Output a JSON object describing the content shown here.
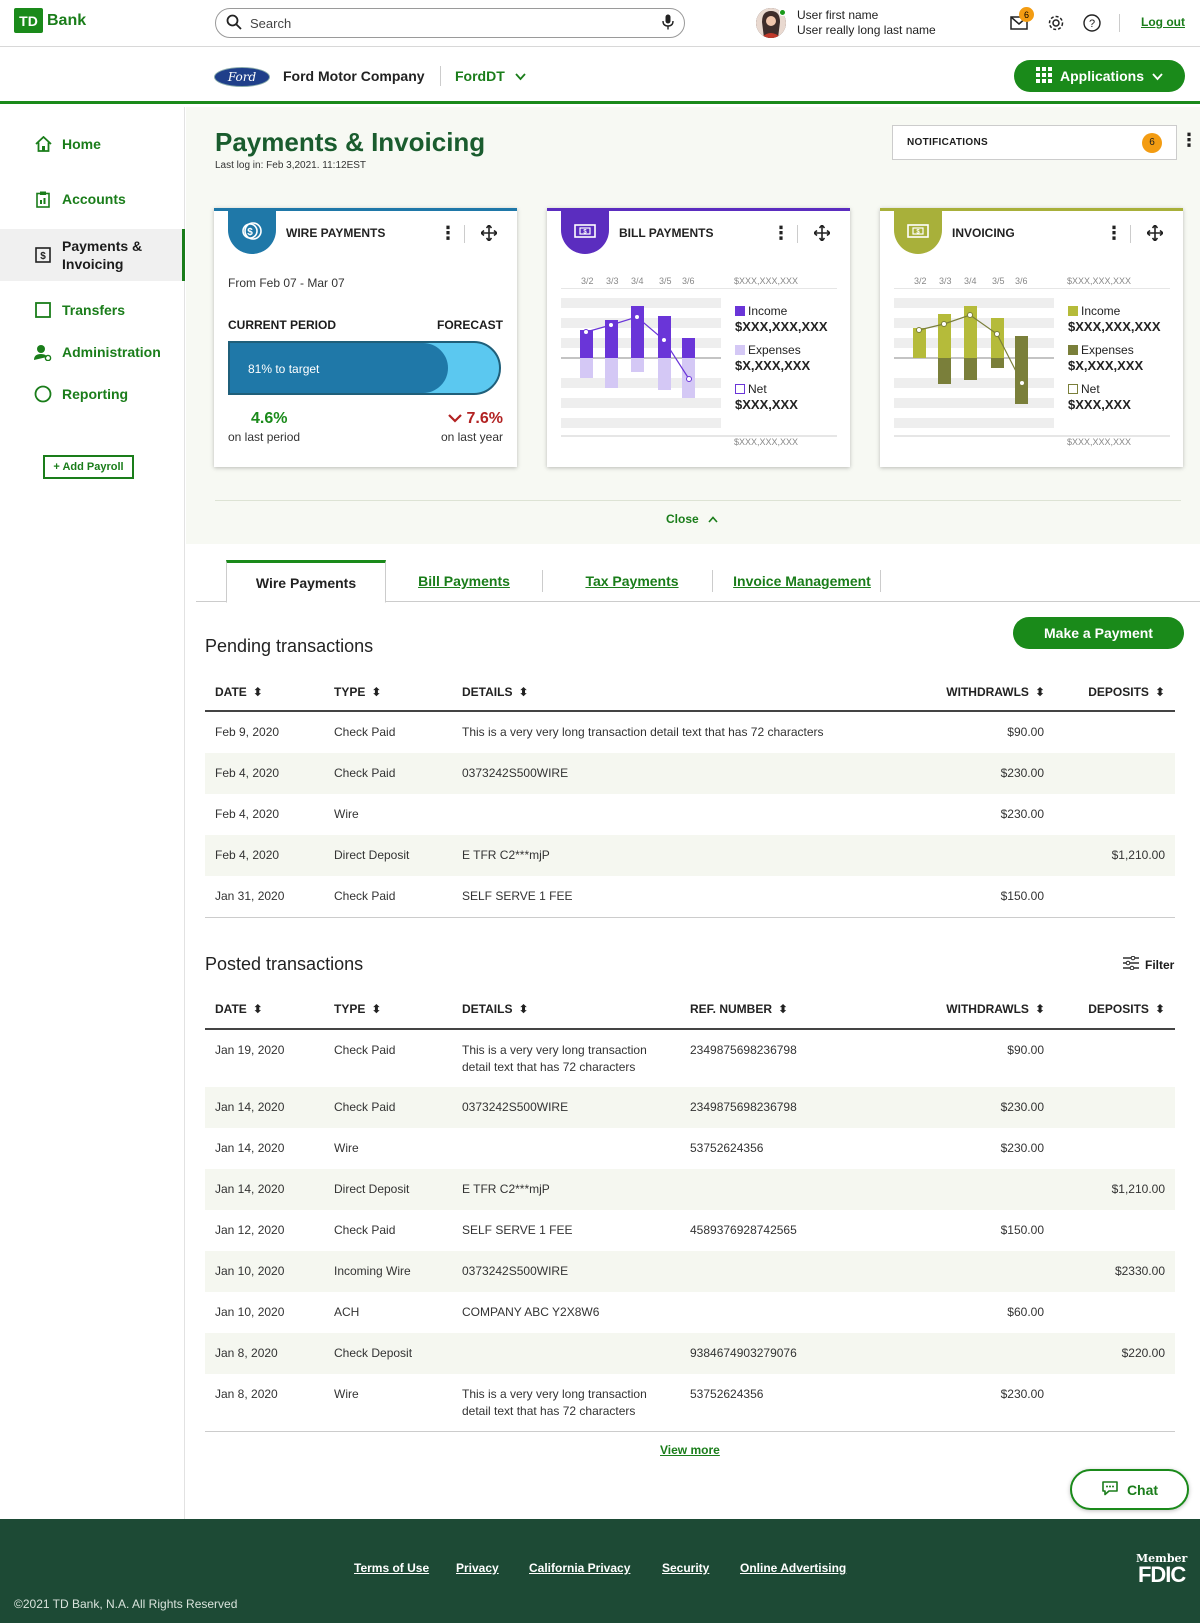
{
  "header": {
    "logo_box": "TD",
    "logo_text": "Bank",
    "search_placeholder": "Search",
    "user_first": "User first name",
    "user_last": "User really long last name",
    "mail_count": "6",
    "logout": "Log out"
  },
  "subbar": {
    "ford_logo": "Ford",
    "company": "Ford Motor Company",
    "account": "FordDT",
    "applications": "Applications"
  },
  "sidebar": {
    "items": [
      {
        "label": "Home"
      },
      {
        "label": "Accounts"
      },
      {
        "label": "Payments & Invoicing"
      },
      {
        "label": "Transfers"
      },
      {
        "label": "Administration"
      },
      {
        "label": "Reporting"
      }
    ],
    "add_payroll": "+ Add Payroll"
  },
  "dashboard": {
    "title": "Payments & Invoicing",
    "last_log": "Last log in: Feb 3,2021. 11:12EST",
    "notifications_label": "NOTIFICATIONS",
    "notifications_count": "6",
    "close": "Close",
    "colors": {
      "wire": "#1f78a8",
      "bill": "#5b2dbf",
      "invoice": "#a8b03a"
    },
    "wire": {
      "title": "WIRE PAYMENTS",
      "range": "From Feb 07 - Mar 07",
      "current_label": "CURRENT PERIOD",
      "forecast_label": "FORECAST",
      "progress_text": "81% to target",
      "progress_value": 0.81,
      "left_value": "4.6%",
      "left_caption": "on last period",
      "right_value": "7.6%",
      "right_caption": "on last year"
    },
    "bill": {
      "title": "BILL PAYMENTS",
      "dates": [
        "3/2",
        "3/3",
        "3/4",
        "3/5",
        "3/6"
      ],
      "top_label": "$XXX,XXX,XXX",
      "bottom_label": "$XXX,XXX,XXX",
      "income_label": "Income",
      "income_value": "$XXX,XXX,XXX",
      "expenses_label": "Expenses",
      "expenses_value": "$X,XXX,XXX",
      "net_label": "Net",
      "net_value": "$XXX,XXX"
    },
    "invoicing": {
      "title": "INVOICING",
      "dates": [
        "3/2",
        "3/3",
        "3/4",
        "3/5",
        "3/6"
      ],
      "top_label": "$XXX,XXX,XXX",
      "bottom_label": "$XXX,XXX,XXX",
      "income_label": "Income",
      "income_value": "$XXX,XXX,XXX",
      "expenses_label": "Expenses",
      "expenses_value": "$X,XXX,XXX",
      "net_label": "Net",
      "net_value": "$XXX,XXX"
    }
  },
  "tabs": [
    {
      "label": "Wire Payments"
    },
    {
      "label": "Bill Payments"
    },
    {
      "label": "Tax Payments"
    },
    {
      "label": "Invoice Management"
    }
  ],
  "pending": {
    "title": "Pending transactions",
    "make_payment": "Make a Payment",
    "headers": [
      "DATE",
      "TYPE",
      "DETAILS",
      "WITHDRAWLS",
      "DEPOSITS"
    ],
    "rows": [
      {
        "date": "Feb 9, 2020",
        "type": "Check Paid",
        "details": "This is a very very long transaction detail text that has 72 characters",
        "withdrawls": "$90.00",
        "deposits": ""
      },
      {
        "date": "Feb 4, 2020",
        "type": "Check Paid",
        "details": "0373242S500WIRE",
        "withdrawls": "$230.00",
        "deposits": ""
      },
      {
        "date": "Feb 4, 2020",
        "type": "Wire",
        "details": "",
        "withdrawls": "$230.00",
        "deposits": ""
      },
      {
        "date": "Feb 4, 2020",
        "type": "Direct Deposit",
        "details": "E TFR C2***mjP",
        "withdrawls": "",
        "deposits": "$1,210.00"
      },
      {
        "date": "Jan 31, 2020",
        "type": "Check Paid",
        "details": "SELF SERVE 1 FEE",
        "withdrawls": "$150.00",
        "deposits": ""
      }
    ]
  },
  "posted": {
    "title": "Posted transactions",
    "filter": "Filter",
    "headers": [
      "DATE",
      "TYPE",
      "DETAILS",
      "REF. NUMBER",
      "WITHDRAWLS",
      "DEPOSITS"
    ],
    "rows": [
      {
        "date": "Jan 19, 2020",
        "type": "Check Paid",
        "details": "This is a very very long transaction detail text that has 72 characters",
        "ref": "2349875698236798",
        "withdrawls": "$90.00",
        "deposits": ""
      },
      {
        "date": "Jan 14, 2020",
        "type": "Check Paid",
        "details": "0373242S500WIRE",
        "ref": "2349875698236798",
        "withdrawls": "$230.00",
        "deposits": ""
      },
      {
        "date": "Jan 14, 2020",
        "type": "Wire",
        "details": "",
        "ref": "53752624356",
        "withdrawls": "$230.00",
        "deposits": ""
      },
      {
        "date": "Jan 14, 2020",
        "type": "Direct Deposit",
        "details": "E TFR C2***mjP",
        "ref": "",
        "withdrawls": "",
        "deposits": "$1,210.00"
      },
      {
        "date": "Jan 12, 2020",
        "type": "Check Paid",
        "details": "SELF SERVE 1 FEE",
        "ref": "4589376928742565",
        "withdrawls": "$150.00",
        "deposits": ""
      },
      {
        "date": "Jan 10, 2020",
        "type": "Incoming Wire",
        "details": "0373242S500WIRE",
        "ref": "",
        "withdrawls": "",
        "deposits": "$2330.00"
      },
      {
        "date": "Jan 10, 2020",
        "type": "ACH",
        "details": "COMPANY ABC Y2X8W6",
        "ref": "",
        "withdrawls": "$60.00",
        "deposits": ""
      },
      {
        "date": "Jan 8, 2020",
        "type": "Check Deposit",
        "details": "",
        "ref": "9384674903279076",
        "withdrawls": "",
        "deposits": "$220.00"
      },
      {
        "date": "Jan 8, 2020",
        "type": "Wire",
        "details": "This is a very very long transaction detail text that has 72 characters",
        "ref": "53752624356",
        "withdrawls": "$230.00",
        "deposits": ""
      }
    ],
    "view_more": "View more"
  },
  "chat": "Chat",
  "footer": {
    "links": [
      "Terms of Use",
      "Privacy",
      "California Privacy",
      "Security",
      "Online Advertising"
    ],
    "copyright": "©2021 TD Bank, N.A. All Rights Reserved",
    "fdic_top": "Member",
    "fdic_bottom": "FDIC"
  }
}
